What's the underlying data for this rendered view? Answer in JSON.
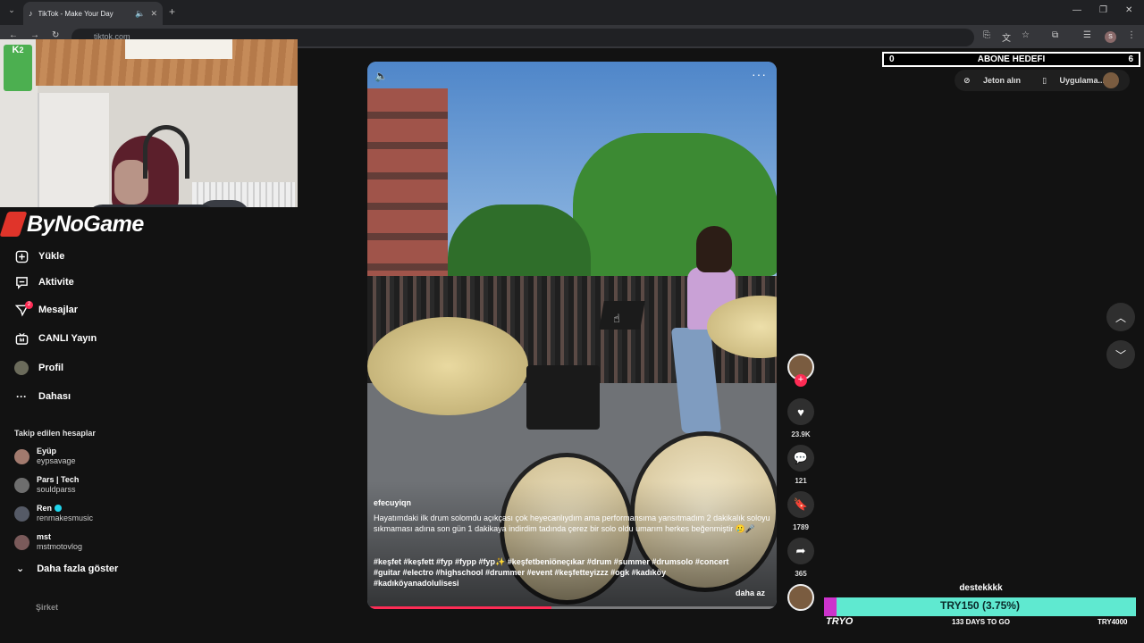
{
  "browser": {
    "tab_title": "TikTok - Make Your Day",
    "url": "tiktok.com"
  },
  "webcam": {
    "badge_letter": "K",
    "badge_number": "2"
  },
  "brand": {
    "name": "ByNoGame",
    "accent": "#e0342a"
  },
  "nav": {
    "items": [
      {
        "label": "Yükle",
        "icon": "upload-icon"
      },
      {
        "label": "Aktivite",
        "icon": "activity-icon"
      },
      {
        "label": "Mesajlar",
        "icon": "messages-icon",
        "badge": "2"
      },
      {
        "label": "CANLI Yayın",
        "icon": "live-icon"
      },
      {
        "label": "Profil",
        "icon": "profile-avatar-icon"
      },
      {
        "label": "Dahası",
        "icon": "more-dots-icon"
      }
    ]
  },
  "following": {
    "heading": "Takip edilen hesaplar",
    "accounts": [
      {
        "name": "Eyüp",
        "handle": "eypsavage",
        "verified": false,
        "color": "#a27a6e"
      },
      {
        "name": "Pars | Tech",
        "handle": "souldparss",
        "verified": false,
        "color": "#6e6e6e"
      },
      {
        "name": "Ren",
        "handle": "renmakesmusic",
        "verified": true,
        "color": "#555a66"
      },
      {
        "name": "mst",
        "handle": "mstmotovlog",
        "verified": false,
        "color": "#7a5a5a"
      }
    ],
    "show_more": "Daha fazla göster"
  },
  "footer": {
    "company": "Şirket"
  },
  "video": {
    "author": "efecuyiqn",
    "caption": "Hayatımdaki ilk drum solomdu açıkçası çok heyecanlıydım ama performansıma yansıtmadım 2 dakikalık soloyu sıkmaması adına son gün 1 dakikaya indirdim tadında çerez bir solo oldu umarım herkes beğenmiştir 🥲🎤",
    "hashtags": "#keşfet #keşfett #fyp #fypp #fyp✨ #keşfetbeniöneçıkar #drum #summer #drumsolo #concert #guitar #electro #highschool #drummer #event #keşfetteyizzz #ogk #kadıköy #kadıköyanadolulisesi",
    "less_label": "daha az",
    "progress": 0.45
  },
  "actions": {
    "likes": "23.9K",
    "comments": "121",
    "saves": "1789",
    "shares": "365"
  },
  "overlay": {
    "abone_left": "0",
    "abone_title": "ABONE HEDEFI",
    "abone_right": "6",
    "jeton_label": "Jeton alın",
    "app_label": "Uygulama..."
  },
  "donation": {
    "name": "destekkkk",
    "progress_text": "TRY150 (3.75%)",
    "progress_fraction": 0.0375,
    "start_label": "TRYO",
    "days_label": "133 DAYS TO GO",
    "goal_label": "TRY4000",
    "bar_color": "#5fe9d0",
    "fill_color": "#cc33cc"
  }
}
